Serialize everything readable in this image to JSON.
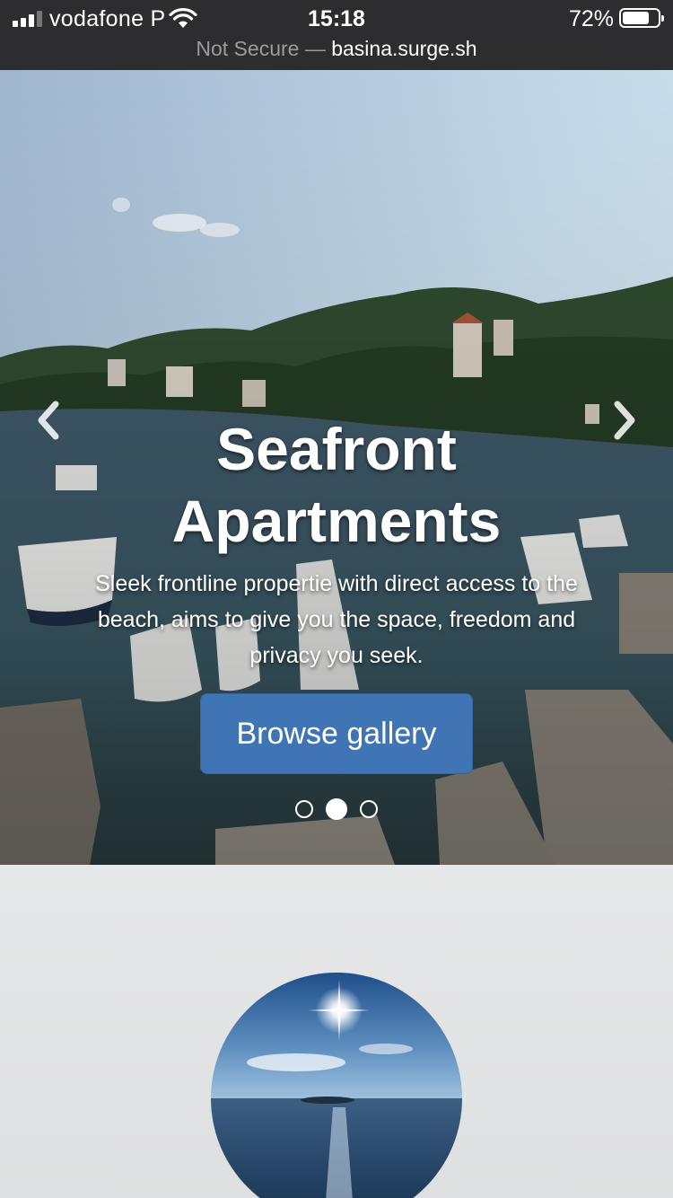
{
  "status_bar": {
    "carrier": "vodafone P",
    "time": "15:18",
    "battery_percent": "72%",
    "battery_level": 0.72
  },
  "browser": {
    "security_label": "Not Secure",
    "separator": "—",
    "host": "basina.surge.sh"
  },
  "hero": {
    "title_line1": "Seafront",
    "title_line2": "Apartments",
    "text": "Sleek frontline propertie with direct access to the beach, aims to give you the space, freedom and privacy you seek.",
    "cta_label": "Browse gallery",
    "slides_total": 3,
    "active_slide": 2,
    "prev_icon": "chevron-left-icon",
    "next_icon": "chevron-right-icon"
  },
  "colors": {
    "status_bg": "#2d2d2f",
    "cta_bg": "#3f74b5",
    "section_bg": "#e4e5e6"
  }
}
